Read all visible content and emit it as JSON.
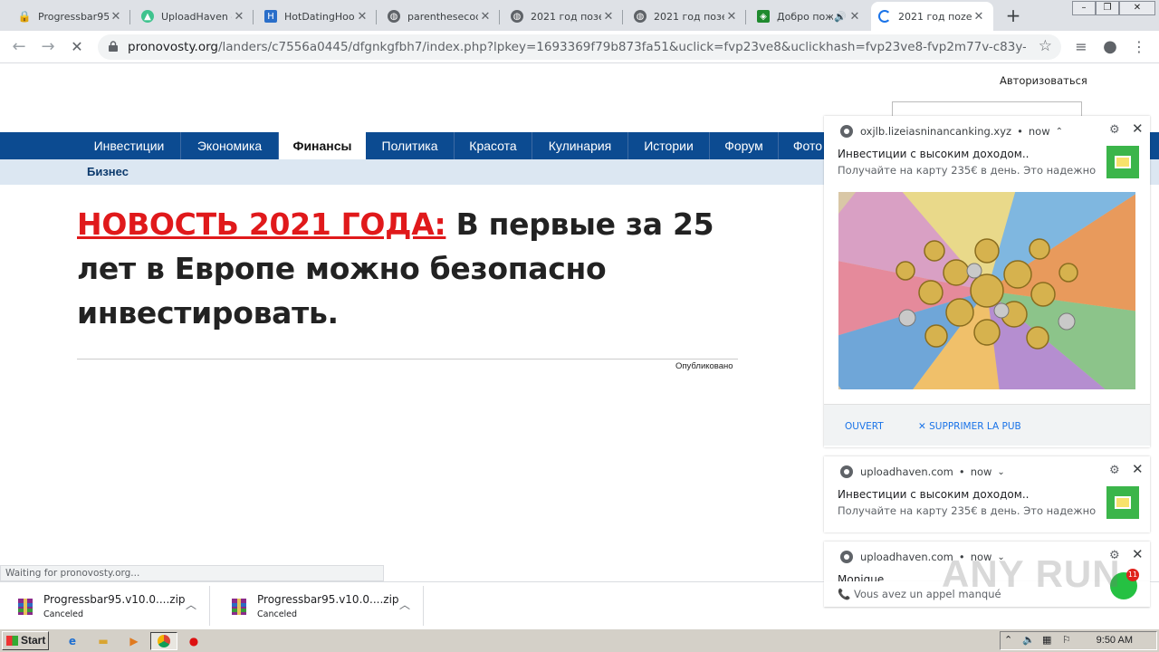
{
  "tabs": [
    {
      "title": "Progressbar95",
      "icon": "lock-red-icon"
    },
    {
      "title": "UploadHaven –",
      "icon": "uploadhaven-icon"
    },
    {
      "title": "HotDatingHook",
      "icon": "hotdating-icon"
    },
    {
      "title": "parenthesecoq",
      "icon": "globe-icon"
    },
    {
      "title": "2021 год позе",
      "icon": "globe-icon"
    },
    {
      "title": "2021 год позе",
      "icon": "globe-icon"
    },
    {
      "title": "Добро пож",
      "icon": "green-app-icon"
    },
    {
      "title": "2021 год поze",
      "icon": "loading-spinner-icon"
    }
  ],
  "toolbar": {
    "url_domain": "pronovosty.org",
    "url_rest": "/landers/c7556a0445/dfgnkgfbh7/index.php?lpkey=1693369f79b873fa51&uclick=fvp23ve8&uclickhash=fvp23ve8-fvp2m77v-c83y-0-x96o-nt..."
  },
  "page": {
    "auth_link": "Авторизоваться",
    "nav": [
      "Инвестиции",
      "Экономика",
      "Финансы",
      "Политика",
      "Красота",
      "Кулинария",
      "Истории",
      "Форум",
      "Фото"
    ],
    "nav_active": "Финансы",
    "subnav": "Бизнес",
    "headline_red": "НОВОСТЬ 2021 ГОДА:",
    "headline_rest": " В первые за 25 лет в Европе можно безопасно инвестировать.",
    "published": "Опубликовано"
  },
  "notifications": [
    {
      "site": "oxjlb.lizeiasninancanking.xyz",
      "time": "now",
      "chevron": "⌃",
      "title": "Инвестиции с высоким доходом..",
      "body": "Получайте на карту 235€ в день. Это надежно",
      "action_open": "OUVERT",
      "action_remove": "SUPPRIMER LA PUB"
    },
    {
      "site": "uploadhaven.com",
      "time": "now",
      "chevron": "⌄",
      "title": "Инвестиции с высоким доходом..",
      "body": "Получайте на карту 235€ в день. Это надежно"
    },
    {
      "site": "uploadhaven.com",
      "time": "now",
      "chevron": "⌄",
      "title": "Monique",
      "body": "Vous avez un appel manqué",
      "badge": "11"
    }
  ],
  "status_text": "Waiting for pronovosty.org...",
  "downloads": [
    {
      "name": "Progressbar95.v10.0....zip",
      "state": "Canceled"
    },
    {
      "name": "Progressbar95.v10.0....zip",
      "state": "Canceled"
    }
  ],
  "taskbar": {
    "start": "Start",
    "clock": "9:50 AM"
  },
  "watermark": "ANY RUN"
}
